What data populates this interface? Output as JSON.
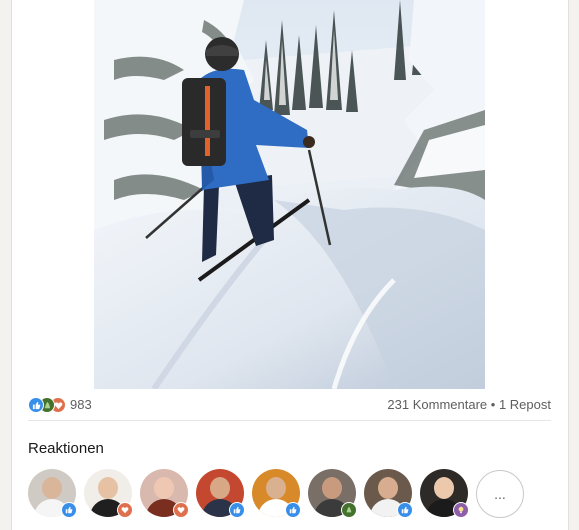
{
  "post": {
    "image_alt": "Skifahrer im Tiefschnee zwischen verschneiten Bäumen"
  },
  "social": {
    "reaction_count": "983",
    "comments": "231 Kommentare",
    "separator": "•",
    "reposts": "1 Repost",
    "reaction_types": [
      "like-icon",
      "celebrate-icon",
      "love-icon"
    ]
  },
  "reactions_section": {
    "title": "Reaktionen",
    "more_label": "...",
    "avatars": [
      {
        "reaction": "like",
        "bg": "#cfcac3",
        "skin": "#d9b59a",
        "shirt": "#f5f5f5"
      },
      {
        "reaction": "love",
        "bg": "#f1ede8",
        "skin": "#e6c1a3",
        "shirt": "#1f1f1f"
      },
      {
        "reaction": "love",
        "bg": "#d9b8ae",
        "skin": "#efc8b3",
        "shirt": "#7a2e20"
      },
      {
        "reaction": "like",
        "bg": "#c4472f",
        "skin": "#d8a786",
        "shirt": "#2a3348"
      },
      {
        "reaction": "like",
        "bg": "#d88a2b",
        "skin": "#d9b090",
        "shirt": "#ffffff"
      },
      {
        "reaction": "celebrate",
        "bg": "#7a6f66",
        "skin": "#c99b7e",
        "shirt": "#3b3b3b"
      },
      {
        "reaction": "like",
        "bg": "#6b5a4b",
        "skin": "#d8ad8f",
        "shirt": "#f2f2f2"
      },
      {
        "reaction": "insightful",
        "bg": "#2e2a27",
        "skin": "#ecc9ad",
        "shirt": "#1b1b1b"
      }
    ]
  },
  "colors": {
    "like": "#378fe9",
    "celebrate": "#44712e",
    "love": "#df704d",
    "insightful": "#8c5fa8"
  }
}
